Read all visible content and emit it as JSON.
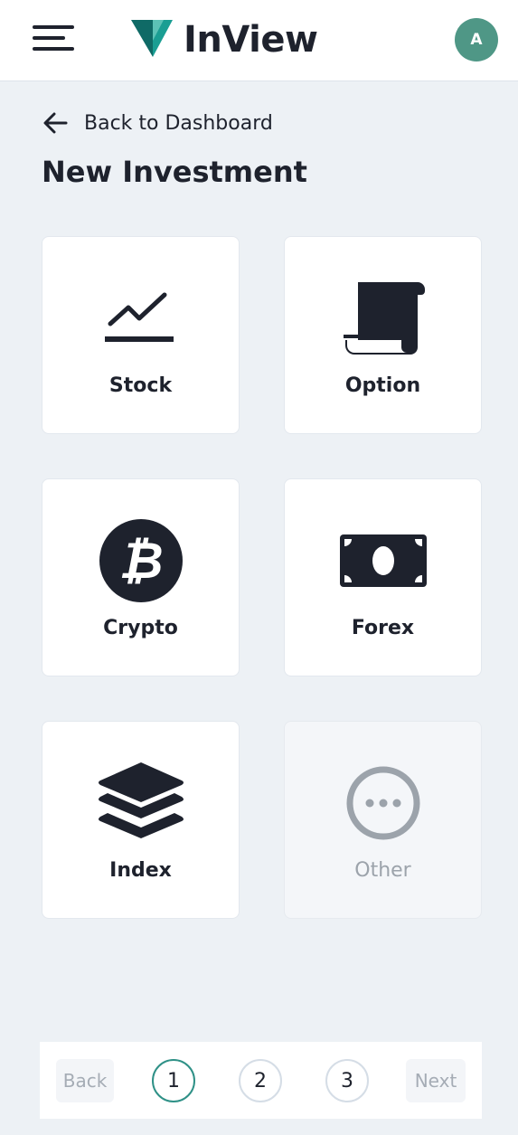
{
  "app": {
    "name": "InView",
    "avatar_initial": "A",
    "accent_color": "#4f9786",
    "logo_colors": [
      "#1a9e93",
      "#0f6a66"
    ]
  },
  "nav": {
    "back_label": "Back to Dashboard",
    "page_title": "New Investment"
  },
  "options": [
    {
      "label": "Stock",
      "icon": "stock-chart-icon",
      "enabled": true
    },
    {
      "label": "Option",
      "icon": "option-scroll-icon",
      "enabled": true
    },
    {
      "label": "Crypto",
      "icon": "bitcoin-icon",
      "enabled": true
    },
    {
      "label": "Forex",
      "icon": "money-bill-icon",
      "enabled": true
    },
    {
      "label": "Index",
      "icon": "layers-icon",
      "enabled": true
    },
    {
      "label": "Other",
      "icon": "more-circle-icon",
      "enabled": false
    }
  ],
  "wizard": {
    "back_label": "Back",
    "next_label": "Next",
    "steps": [
      "1",
      "2",
      "3"
    ],
    "current_step": 1,
    "active_color": "#2f9187"
  }
}
